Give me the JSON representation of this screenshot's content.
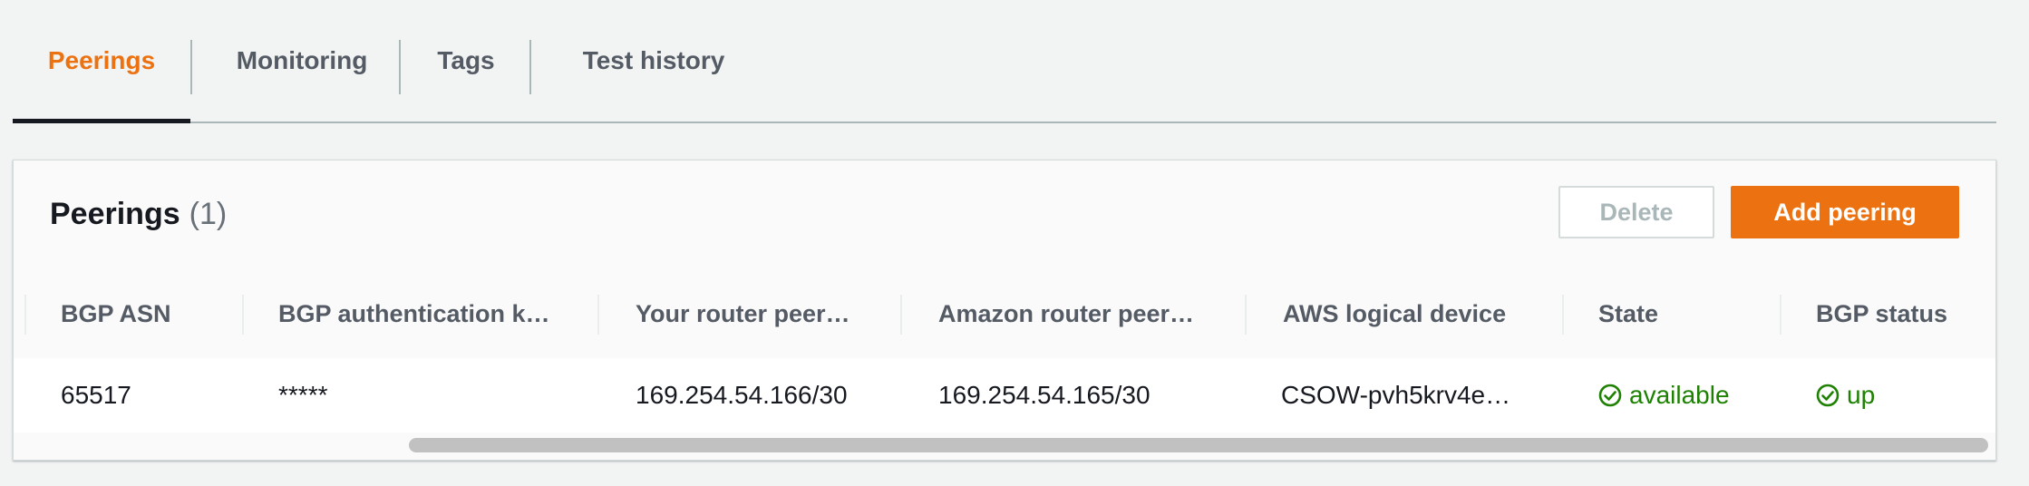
{
  "tabs": [
    {
      "label": "Peerings",
      "active": true
    },
    {
      "label": "Monitoring",
      "active": false
    },
    {
      "label": "Tags",
      "active": false
    },
    {
      "label": "Test history",
      "active": false
    }
  ],
  "panel": {
    "title": "Peerings",
    "count": "(1)",
    "delete_label": "Delete",
    "add_label": "Add peering"
  },
  "table": {
    "columns": [
      "BGP ASN",
      "BGP authentication k…",
      "Your router peer…",
      "Amazon router peer…",
      "AWS logical device",
      "State",
      "BGP status"
    ],
    "rows": [
      {
        "bgp_asn": "65517",
        "bgp_auth_key": "*****",
        "your_router_peer": "169.254.54.166/30",
        "amazon_router_peer": "169.254.54.165/30",
        "aws_logical_device": "CSOW-pvh5krv4e…",
        "state": "available",
        "bgp_status": "up"
      }
    ]
  },
  "colors": {
    "accent": "#ec7211",
    "success": "#1d8102",
    "text_dark": "#16191f",
    "text_muted": "#545b64"
  },
  "icons": {
    "state_icon": "check-circle-icon",
    "bgp_status_icon": "check-circle-icon"
  }
}
